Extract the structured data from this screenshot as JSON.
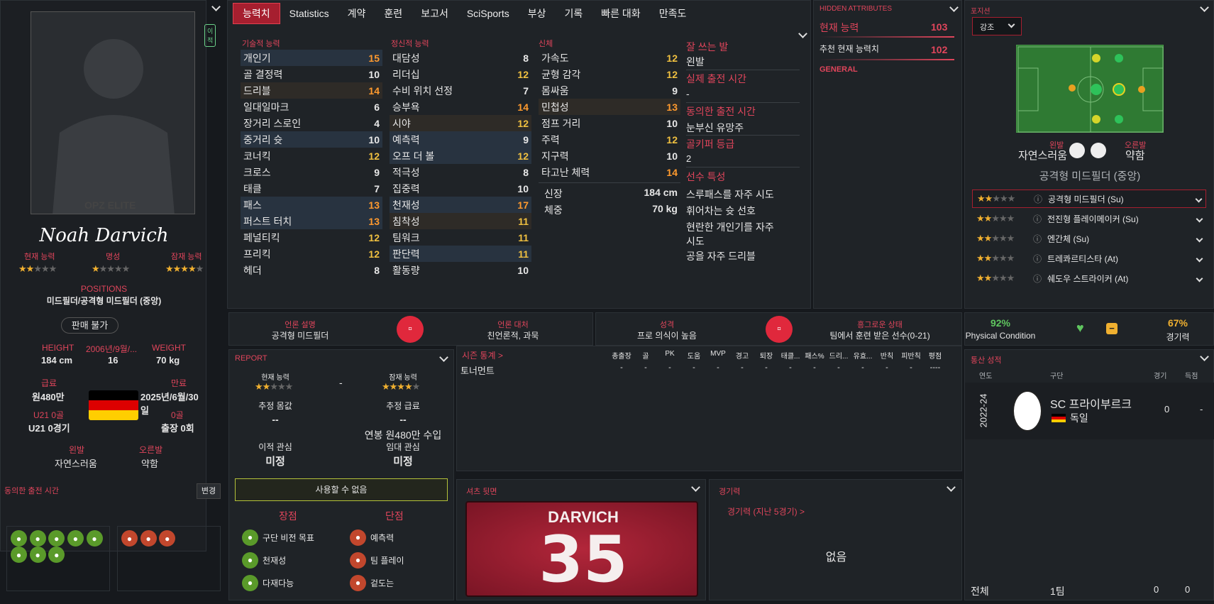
{
  "player": {
    "name": "Noah Darvich",
    "cur_label": "현재 능력",
    "rep_label": "명성",
    "pot_label": "잠재 능력",
    "cur_stars": 2,
    "rep_stars": 1.5,
    "pot_stars": 4.5,
    "positions_label": "POSITIONS",
    "positions": "미드필더/공격형 미드필더 (중앙)",
    "sale_btn": "판매 불가",
    "height_label": "HEIGHT",
    "height": "184 cm",
    "dob_label": "2006년/9월/...",
    "age": "16",
    "weight_label": "WEIGHT",
    "weight": "70 kg",
    "wage_label": "급료",
    "wage": "원480만",
    "expiry_label": "만료",
    "expiry": "2025년/6월/30일",
    "u21_goals_label": "U21 0골",
    "u21_apps": "U21 0경기",
    "goals_label": "0골",
    "apps": "출장 0회",
    "left_foot_label": "왼발",
    "left_foot": "자연스러움",
    "right_foot_label": "오른발",
    "right_foot": "약함",
    "agreed_time_label": "동의한 출전 시간",
    "change_btn": "변경",
    "watermark": "OPZ ELITE",
    "transfer_badge": "이적"
  },
  "tabs": [
    "능력치",
    "Statistics",
    "계약",
    "훈련",
    "보고서",
    "SciSports",
    "부상",
    "기록",
    "빠른 대화",
    "만족도"
  ],
  "attributes": {
    "technical_label": "기술적 능력",
    "mental_label": "정신적 능력",
    "physical_label": "신체",
    "technical": [
      [
        "개인기",
        "15"
      ],
      [
        "골 결정력",
        "10"
      ],
      [
        "드리블",
        "14"
      ],
      [
        "일대일마크",
        "6"
      ],
      [
        "장거리 스로인",
        "4"
      ],
      [
        "중거리 슛",
        "10"
      ],
      [
        "코너킥",
        "12"
      ],
      [
        "크로스",
        "9"
      ],
      [
        "태클",
        "7"
      ],
      [
        "패스",
        "13"
      ],
      [
        "퍼스트 터치",
        "13"
      ],
      [
        "페널티킥",
        "12"
      ],
      [
        "프리킥",
        "12"
      ],
      [
        "헤더",
        "8"
      ]
    ],
    "mental": [
      [
        "대담성",
        "8"
      ],
      [
        "리더십",
        "12"
      ],
      [
        "수비 위치 선정",
        "7"
      ],
      [
        "승부욕",
        "14"
      ],
      [
        "시야",
        "12"
      ],
      [
        "예측력",
        "9"
      ],
      [
        "오프 더 볼",
        "12"
      ],
      [
        "적극성",
        "8"
      ],
      [
        "집중력",
        "10"
      ],
      [
        "천재성",
        "17"
      ],
      [
        "침착성",
        "11"
      ],
      [
        "팀워크",
        "11"
      ],
      [
        "판단력",
        "11"
      ],
      [
        "활동량",
        "10"
      ]
    ],
    "physical": [
      [
        "가속도",
        "12"
      ],
      [
        "균형 감각",
        "12"
      ],
      [
        "몸싸움",
        "9"
      ],
      [
        "민첩성",
        "13"
      ],
      [
        "점프 거리",
        "10"
      ],
      [
        "주력",
        "12"
      ],
      [
        "지구력",
        "10"
      ],
      [
        "타고난 체력",
        "14"
      ]
    ],
    "height_label": "신장",
    "height": "184 cm",
    "weight_label": "체중",
    "weight": "70 kg"
  },
  "info": {
    "foot_label": "잘 쓰는 발",
    "foot": "왼발",
    "actual_time_label": "실제 출전 시간",
    "actual_time": "-",
    "agreed_label": "동의한 출전 시간",
    "agreed": "눈부신 유망주",
    "gk_label": "골키퍼 등급",
    "gk": "2",
    "traits_label": "선수 특성",
    "traits": [
      "스루패스를 자주 시도",
      "휘어차는 슛 선호",
      "현란한 개인기를 자주 시도",
      "공을 자주 드리블"
    ]
  },
  "hidden": {
    "title": "HIDDEN ATTRIBUTES",
    "cur_label": "현재 능력",
    "cur": "103",
    "rec_label": "추천 현재 능력치",
    "rec": "102",
    "general": "GENERAL"
  },
  "position": {
    "title": "포지션",
    "dropdown": "강조",
    "left_foot_label": "왼발",
    "left_foot": "자연스러움",
    "right_foot_label": "오른발",
    "right_foot": "약함",
    "role_name": "공격형 미드필더 (중앙)",
    "roles": [
      {
        "name": "공격형 미드필더 (Su)",
        "stars": 2
      },
      {
        "name": "전진형 플레이메이커 (Su)",
        "stars": 2
      },
      {
        "name": "엔간체 (Su)",
        "stars": 2
      },
      {
        "name": "트레콰르티스타 (At)",
        "stars": 2
      },
      {
        "name": "쉐도우 스트라이커 (At)",
        "stars": 2
      }
    ]
  },
  "media": {
    "desc_label": "언론 설명",
    "desc": "공격형 미드필더",
    "handling_label": "언론 대처",
    "handling": "친언론적, 과묵",
    "personality_label": "성격",
    "personality": "프로 의식이 높음",
    "status_label": "흥그로운 상태",
    "status": "팀에서 훈련 받은 선수(0-21)"
  },
  "condition": {
    "physical": "92%",
    "physical_label": "Physical Condition",
    "match": "67%",
    "match_label": "경기력"
  },
  "report": {
    "title": "REPORT",
    "cur_label": "현재 능력",
    "pot_label": "잠재 능력",
    "cur_stars": 2,
    "pot_stars": 4,
    "dash": "-",
    "value_label": "추정 몸값",
    "value": "--",
    "wage_label": "추정 급료",
    "wage": "--",
    "wage_sub": "연봉 원480만 수입",
    "transfer_label": "이적 관심",
    "transfer": "미정",
    "loan_label": "임대 관심",
    "loan": "미정",
    "unavailable": "사용할 수 없음",
    "strengths_label": "장점",
    "weaknesses_label": "단점",
    "strengths": [
      "구단 비전 목표",
      "천재성",
      "다재다능"
    ],
    "weaknesses": [
      "예측력",
      "팀 플레이",
      "겉도는"
    ]
  },
  "season": {
    "title": "시즌 통계 >",
    "cols": [
      "총출장",
      "골",
      "PK",
      "도움",
      "MVP",
      "경고",
      "퇴장",
      "태클...",
      "패스%",
      "드리...",
      "유효...",
      "반칙",
      "피반칙",
      "평점"
    ],
    "rows": [
      {
        "name": "토너먼트",
        "vals": [
          "-",
          "-",
          "-",
          "-",
          "-",
          "-",
          "-",
          "-",
          "-",
          "-",
          "-",
          "-",
          "-",
          "----"
        ]
      }
    ]
  },
  "shirt": {
    "title": "셔츠 뒷면",
    "name": "DARVICH",
    "number": "35"
  },
  "form": {
    "title": "경기력",
    "link": "경기력 (지난 5경기) >",
    "empty": "없음"
  },
  "career": {
    "title": "통산 성적",
    "col_year": "연도",
    "col_club": "구단",
    "col_apps": "경기",
    "col_goals": "득점",
    "season": "2022-24",
    "club": "SC 프라이부르크",
    "country": "독일",
    "apps": "0",
    "goals": "-",
    "total_label": "전체",
    "total_team": "1팀",
    "total_apps": "0",
    "total_goals": "0"
  }
}
